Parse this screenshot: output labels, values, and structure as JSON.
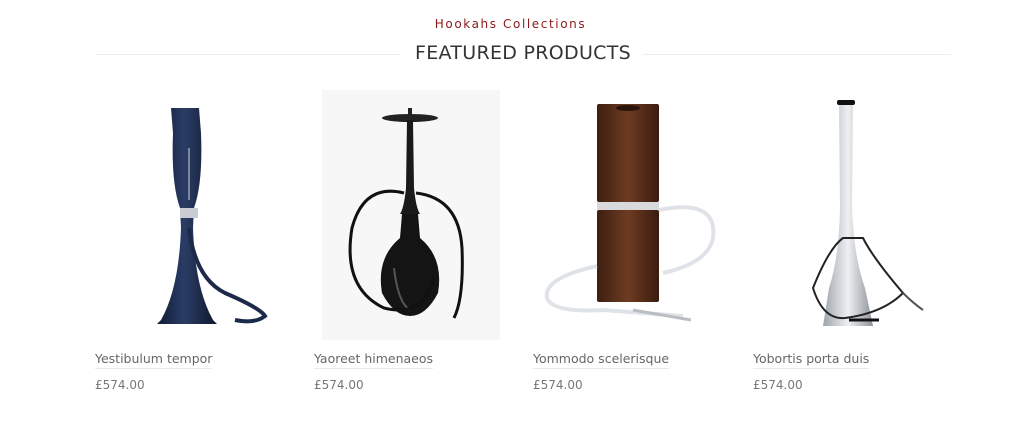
{
  "section": {
    "subtitle": "Hookahs Collections",
    "title": "FEATURED PRODUCTS"
  },
  "products": [
    {
      "name": "Yestibulum tempor",
      "price": "£574.00",
      "icon": "navy-hookah-image"
    },
    {
      "name": "Yaoreet himenaeos",
      "price": "£574.00",
      "icon": "black-hookah-image"
    },
    {
      "name": "Yommodo scelerisque",
      "price": "£574.00",
      "icon": "wooden-hookah-image"
    },
    {
      "name": "Yobortis porta duis",
      "price": "£574.00",
      "icon": "silver-hookah-image"
    }
  ],
  "colors": {
    "accent": "#8b1a1a",
    "navy_hookah": "#1c2a4a",
    "wood_hookah": "#5a2f1a"
  }
}
